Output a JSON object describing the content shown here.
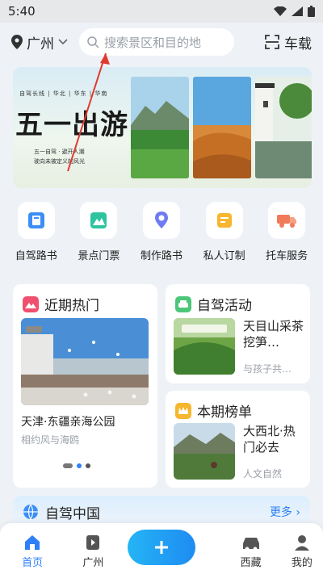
{
  "status": {
    "time": "5:40"
  },
  "topbar": {
    "city": "广州",
    "search_placeholder": "搜索景区和目的地",
    "scan_label": "车载"
  },
  "banner": {
    "route": "自驾长线 | 华北 | 华东 | 华南",
    "title": "五一出游",
    "sub_line1": "五一自驾 · 避开人潮",
    "sub_line2": "驶向未被定义的风光"
  },
  "quick_links": [
    {
      "label": "自驾路书",
      "icon": "book-icon",
      "color": "#3b8ef5"
    },
    {
      "label": "景点门票",
      "icon": "mountain-ticket-icon",
      "color": "#2fc4a0"
    },
    {
      "label": "制作路书",
      "icon": "pin-person-icon",
      "color": "#6e7cf3"
    },
    {
      "label": "私人订制",
      "icon": "custom-card-icon",
      "color": "#f6b62e"
    },
    {
      "label": "托车服务",
      "icon": "truck-icon",
      "color": "#f07a5a"
    }
  ],
  "hot": {
    "title": "近期热门",
    "place": "天津·东疆亲海公园",
    "desc": "相约风与海鸥"
  },
  "activity": {
    "title": "自驾活动",
    "item_title": "天目山采茶挖笋…",
    "item_sub": "与孩子共…"
  },
  "ranking": {
    "title": "本期榜单",
    "item_title": "大西北·热门必去",
    "item_sub": "人文自然"
  },
  "section": {
    "title": "自驾中国",
    "more": "更多 ›"
  },
  "tabs": [
    {
      "label": "首页",
      "icon": "home-icon",
      "active": true
    },
    {
      "label": "广州",
      "icon": "city-icon",
      "active": false
    },
    {
      "label": "西藏",
      "icon": "car-icon",
      "active": false
    },
    {
      "label": "我的",
      "icon": "profile-icon",
      "active": false
    }
  ],
  "colors": {
    "accent": "#2f7ff7",
    "annotation": "#e03a2e"
  }
}
